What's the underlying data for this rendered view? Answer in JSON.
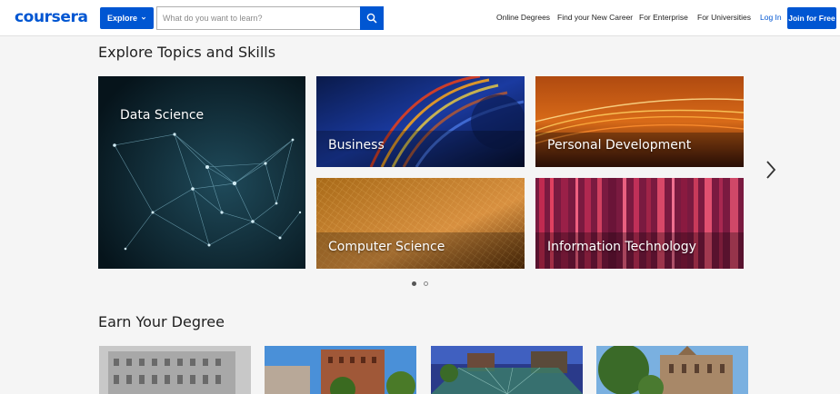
{
  "header": {
    "logo": "coursera",
    "explore_label": "Explore",
    "search_placeholder": "What do you want to learn?",
    "nav": {
      "online_degrees": "Online Degrees",
      "new_career": "Find your New Career",
      "enterprise": "For Enterprise",
      "universities": "For Universities",
      "login": "Log In",
      "join": "Join for Free"
    }
  },
  "topics": {
    "title": "Explore Topics and Skills",
    "tiles": [
      "Data Science",
      "Business",
      "Personal Development",
      "Computer Science",
      "Information Technology"
    ],
    "active_page": 1,
    "page_count": 2
  },
  "degrees": {
    "title": "Earn Your Degree"
  },
  "colors": {
    "brand": "#0056d2",
    "background": "#f5f5f5"
  },
  "icons": [
    "search-icon",
    "chevron-down-icon",
    "chevron-right-icon"
  ]
}
